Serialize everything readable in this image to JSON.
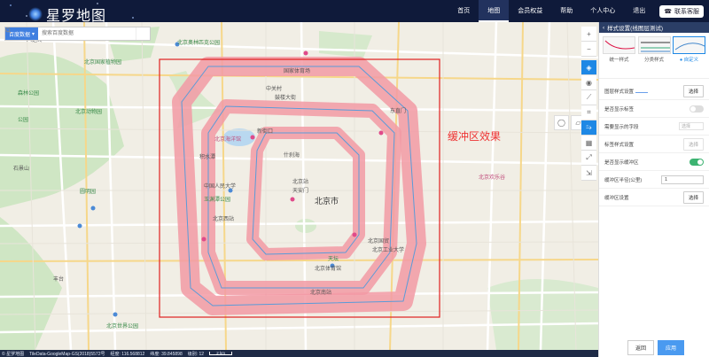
{
  "header": {
    "logo_text": "星罗地图",
    "nav": [
      {
        "label": "首页"
      },
      {
        "label": "地图"
      },
      {
        "label": "会员权益"
      },
      {
        "label": "帮助"
      },
      {
        "label": "个人中心"
      },
      {
        "label": "退出"
      }
    ],
    "contact_label": "联系客服",
    "contact_icon": "headset-icon"
  },
  "search": {
    "source_label": "百度数据",
    "placeholder": "搜索百度数据",
    "icon": "search-icon"
  },
  "map": {
    "annotation": "缓冲区效果",
    "city_label": "北京市",
    "labels": [
      "北京奥林匹克公园",
      "北京国家植物园",
      "北京动物园",
      "中关村",
      "森林公园",
      "八达岭",
      "公园",
      "北京海洋馆",
      "积水潭",
      "东直门",
      "什刹海",
      "北京市",
      "天安门",
      "北京站",
      "北京世界公园",
      "北京西站",
      "北京国贸",
      "北京工业大学",
      "北京南站",
      "中国人民大学",
      "鼓楼大街",
      "玉渊潭公园",
      "圆明园",
      "天坛",
      "石景山",
      "北京欢乐谷",
      "北京体育馆",
      "新街口",
      "国家体育场",
      "丰台"
    ],
    "stroke_color": "#f08a98",
    "frame_color": "#e02020"
  },
  "toolbar": {
    "tools": [
      "plus-icon",
      "minus-icon",
      "layers-icon",
      "eye-icon",
      "ruler-icon",
      "crop-icon",
      "buffer-icon",
      "chart-icon",
      "fullscreen-icon",
      "export-icon"
    ],
    "side_tools": [
      "circle-select-icon",
      "rect-select-icon"
    ]
  },
  "status": {
    "copyright": "© 星罗地图",
    "data_source": "TileData-GoogleMap-GS(2018)5572号",
    "lng_label": "经度: 116.568812",
    "lat_label": "纬度: 39.845898",
    "zoom_label": "级别: 12",
    "scale_label": "2 km"
  },
  "panel": {
    "title": "样式设置(线图层测试)",
    "tabs": [
      {
        "label": "统一样式"
      },
      {
        "label": "分类样式"
      },
      {
        "label": "自定义"
      }
    ],
    "rows": {
      "layer_style_label": "图层样式设置",
      "layer_style_btn": "选择",
      "show_label_label": "是否显示标签",
      "field_label": "需要显示的字段",
      "field_placeholder": "选择",
      "label_style_label": "标签样式设置",
      "label_style_btn": "选择",
      "show_buffer_label": "是否显示缓冲区",
      "buffer_radius_label": "缓冲区半径(公里)",
      "buffer_radius_value": "1",
      "buffer_style_label": "缓冲区设置",
      "buffer_style_btn": "选择"
    },
    "footer": {
      "back_label": "返回",
      "apply_label": "应用"
    }
  }
}
